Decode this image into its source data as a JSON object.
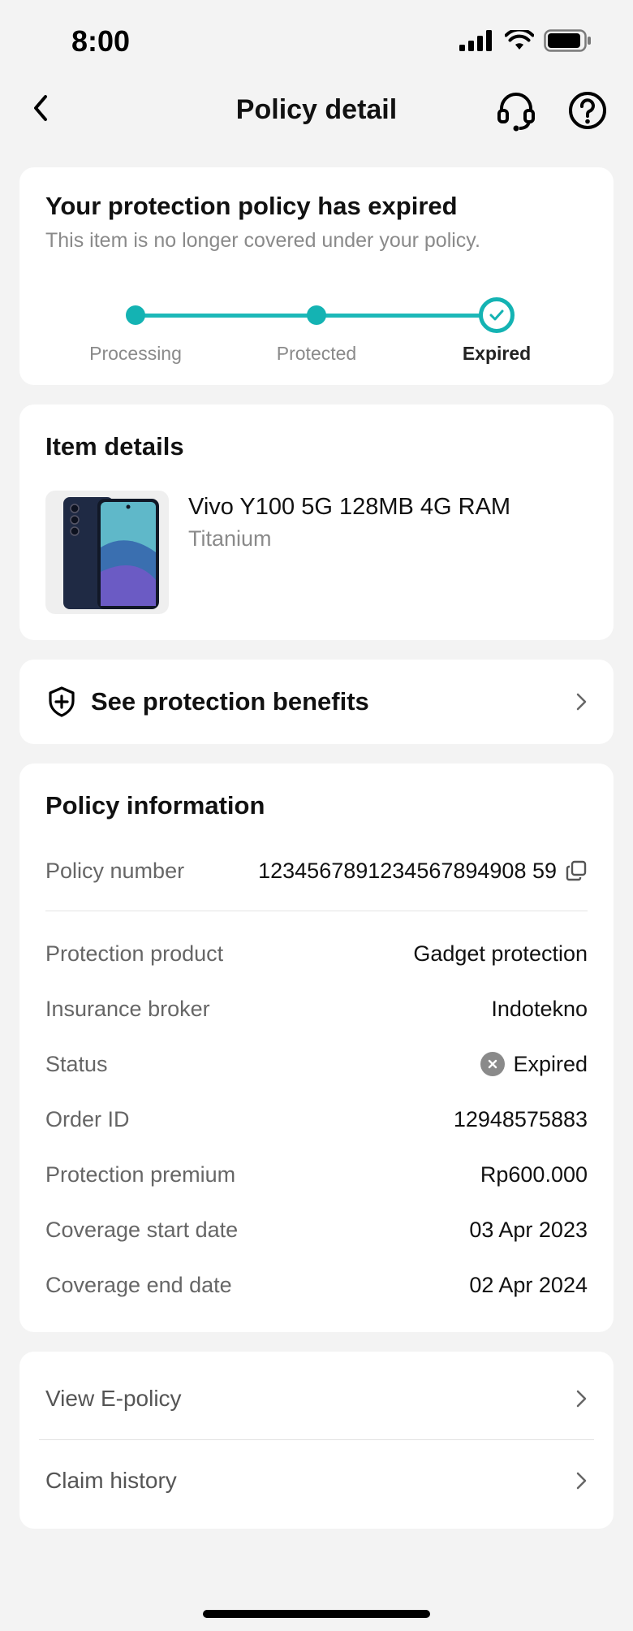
{
  "status_bar": {
    "time": "8:00"
  },
  "header": {
    "title": "Policy detail"
  },
  "status_card": {
    "title": "Your protection policy has expired",
    "subtitle": "This item is no longer covered under your policy.",
    "steps": [
      "Processing",
      "Protected",
      "Expired"
    ],
    "active_step": "Expired",
    "accent_color": "#14b3b3"
  },
  "item_card": {
    "heading": "Item details",
    "name": "Vivo Y100 5G 128MB 4G RAM",
    "variant": "Titanium"
  },
  "benefits": {
    "label": "See protection benefits"
  },
  "policy": {
    "heading": "Policy information",
    "policy_number_label": "Policy number",
    "policy_number": "1234567891234567894908 59",
    "rows": [
      {
        "label": "Protection product",
        "value": "Gadget protection"
      },
      {
        "label": "Insurance broker",
        "value": "Indotekno"
      },
      {
        "label": "Status",
        "value": "Expired"
      },
      {
        "label": "Order ID",
        "value": "12948575883"
      },
      {
        "label": "Protection premium",
        "value": "Rp600.000"
      },
      {
        "label": "Coverage start date",
        "value": "03 Apr 2023"
      },
      {
        "label": "Coverage end date",
        "value": "02 Apr 2024"
      }
    ]
  },
  "links": [
    {
      "label": "View E-policy"
    },
    {
      "label": "Claim history"
    }
  ]
}
